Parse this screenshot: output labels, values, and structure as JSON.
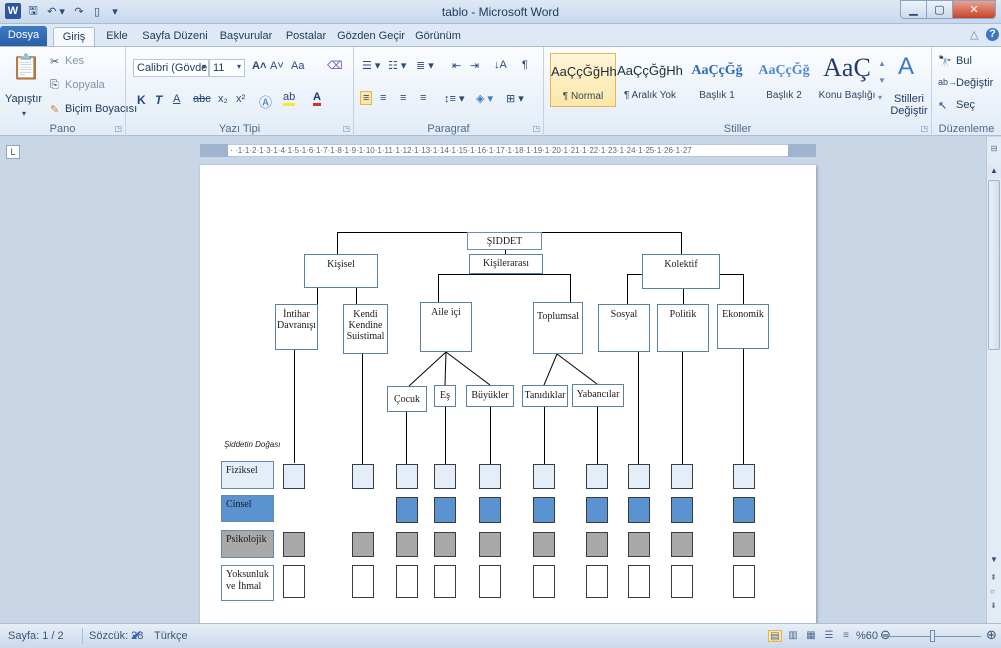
{
  "window": {
    "title": "tablo - Microsoft Word"
  },
  "quick_access": {
    "logo": "W",
    "save_icon": "save-icon",
    "undo": "↶ ▾",
    "redo": "↷",
    "new_icon": "new-doc-icon",
    "more": "▾"
  },
  "tabs": [
    "Dosya",
    "Giriş",
    "Ekle",
    "Sayfa Düzeni",
    "Başvurular",
    "Postalar",
    "Gözden Geçir",
    "Görünüm"
  ],
  "ribbon": {
    "clipboard": {
      "paste": "Yapıştır",
      "cut": "Kes",
      "copy": "Kopyala",
      "format_painter": "Biçim Boyacısı",
      "label": "Pano"
    },
    "font": {
      "name": "Calibri (Gövde",
      "size": "11",
      "label": "Yazı Tipi",
      "bold": "K",
      "italic": "T",
      "underline": "A",
      "strike": "abc",
      "sub": "x₂",
      "sup": "x²",
      "grow": "A˄",
      "shrink": "A˅",
      "case": "Aa"
    },
    "paragraph": {
      "label": "Paragraf"
    },
    "styles": {
      "label": "Stiller",
      "items": [
        {
          "sample": "AaÇçĞğHh",
          "name": "¶ Normal"
        },
        {
          "sample": "AaÇçĞğHh",
          "name": "¶ Aralık Yok"
        },
        {
          "sample": "AaÇçĞğ",
          "name": "Başlık 1"
        },
        {
          "sample": "AaÇçĞğ",
          "name": "Başlık 2"
        },
        {
          "sample": "AaÇ",
          "name": "Konu Başlığı"
        }
      ],
      "change": "Stilleri Değiştir"
    },
    "editing": {
      "label": "Düzenleme",
      "find": "Bul",
      "replace": "Değiştir",
      "select": "Seç"
    }
  },
  "ruler": {
    "text": "·2·1·1· · ·1·1·2·1·3·1·4·1·5·1·6·1·7·1·8·1·9·1·10·1·11·1·12·1·13·1·14·1·15·1·16·1·17·1·18·1·19·1·20·1·21·1·22·1·23·1·24·1·25·1·26·1·27",
    "corner": "L"
  },
  "diagram": {
    "root": "ŞIDDET",
    "level1": [
      "Kişisel",
      "Kişilerarası",
      "Kolektif"
    ],
    "level2": [
      "İntihar Davranışı",
      "Kendi Kendine Suistimal",
      "Aile içi",
      "Toplumsal",
      "Sosyal",
      "Politik",
      "Ekonomik"
    ],
    "level3": [
      "Çocuk",
      "Eş",
      "Büyükler",
      "Tanıdıklar",
      "Yabancılar"
    ],
    "nature_label": "Şiddetin Doğası",
    "nature_types": [
      "Fiziksel",
      "Cinsel",
      "Psikolojik",
      "Yoksunluk ve İhmal"
    ],
    "colors": {
      "fiziksel": "#e4eef8",
      "cinsel": "#5b93d1",
      "psikolojik": "#a9a9a9",
      "yoksunluk": "#ffffff"
    }
  },
  "status": {
    "page": "Sayfa: 1 / 2",
    "words": "Sözcük: 28",
    "language": "Türkçe",
    "zoom": "%60"
  }
}
